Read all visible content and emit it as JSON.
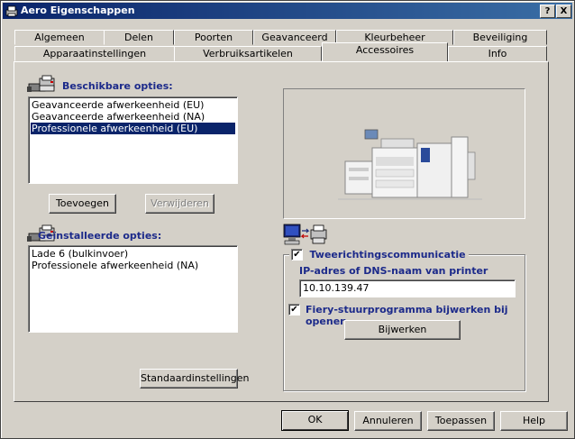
{
  "window": {
    "title": "Aero Eigenschappen",
    "help_label": "?",
    "close_label": "X"
  },
  "tabs_row1": [
    "Algemeen",
    "Delen",
    "Poorten",
    "Geavanceerd",
    "Kleurbeheer",
    "Beveiliging"
  ],
  "tabs_row2": [
    "Apparaatinstellingen",
    "Verbruiksartikelen",
    "Accessoires",
    "Info"
  ],
  "active_tab": "Accessoires",
  "available": {
    "heading": "Beschikbare opties:",
    "items": [
      "Geavanceerde afwerkeenheid (EU)",
      "Geavanceerde afwerkeenheid (NA)",
      "Professionele afwerkeenheid (EU)"
    ],
    "selected_index": 2,
    "add_label": "Toevoegen",
    "remove_label": "Verwijderen"
  },
  "installed": {
    "heading": "Geïnstalleerde opties:",
    "items": [
      "Lade 6 (bulkinvoer)",
      "Professionele afwerkeenheid (NA)"
    ],
    "defaults_label": "Standaardinstellingen"
  },
  "bidi": {
    "checkbox_label": "Tweerichtingscommunicatie",
    "checked": true,
    "ip_label": "IP-adres of DNS-naam van printer",
    "ip_value": "10.10.139.47",
    "fiery_label": "Fiery-stuurprogramma bijwerken bij openen",
    "fiery_checked": true,
    "update_label": "Bijwerken"
  },
  "footer": {
    "ok_label": "OK",
    "cancel_label": "Annuleren",
    "apply_label": "Toepassen",
    "help_label": "Help"
  },
  "colors": {
    "title_start": "#0a246a",
    "title_end": "#3a6ea5",
    "heading": "#1c2a8a",
    "selection": "#0a246a"
  }
}
